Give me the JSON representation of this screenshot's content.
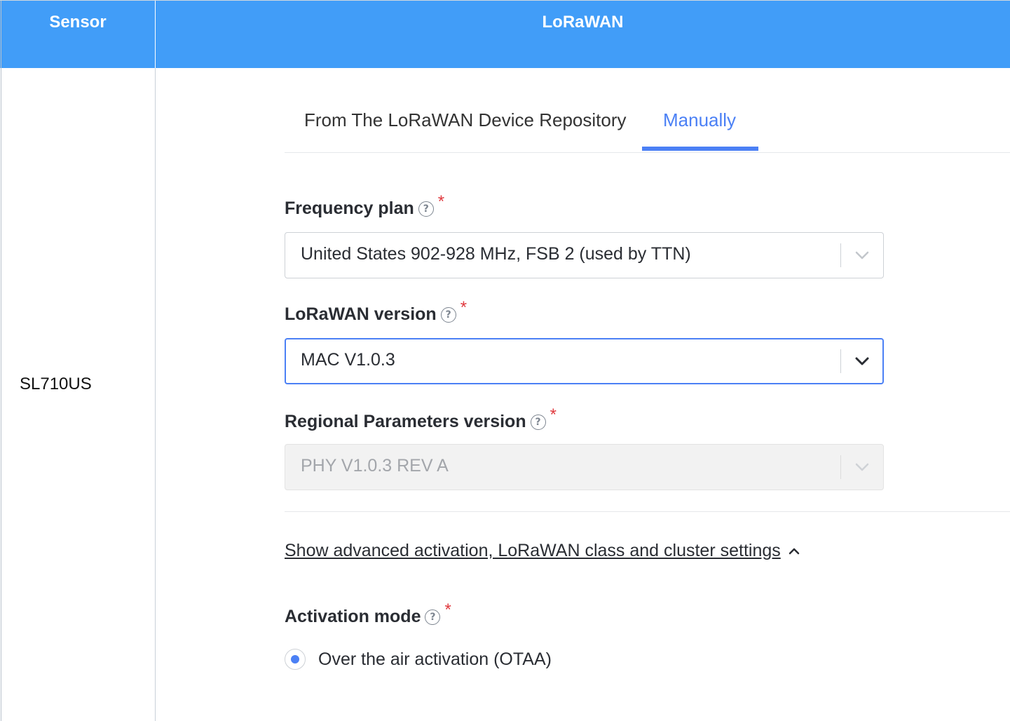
{
  "table": {
    "headers": {
      "sensor": "Sensor",
      "lorawan": "LoRaWAN"
    },
    "row": {
      "sensor": "SL710US"
    }
  },
  "tabs": [
    {
      "label": "From The LoRaWAN Device Repository",
      "active": false
    },
    {
      "label": "Manually",
      "active": true
    }
  ],
  "form": {
    "frequency_plan": {
      "label": "Frequency plan",
      "required_mark": "*",
      "value": "United States 902-928 MHz, FSB 2 (used by TTN)"
    },
    "lorawan_version": {
      "label": "LoRaWAN version",
      "required_mark": "*",
      "value": "MAC V1.0.3"
    },
    "regional_parameters_version": {
      "label": "Regional Parameters version",
      "required_mark": "*",
      "value": "PHY V1.0.3 REV A",
      "disabled": true
    },
    "advanced_link": "Show advanced activation, LoRaWAN class and cluster settings",
    "activation_mode": {
      "label": "Activation mode",
      "required_mark": "*",
      "option": "Over the air activation (OTAA)",
      "selected": true
    }
  },
  "icons": {
    "help": "help-circle-icon",
    "chevron": "chevron-down-icon",
    "caret_up": "caret-up-icon"
  },
  "colors": {
    "header_bg": "#419df8",
    "accent": "#4b80f5",
    "required": "#e0393e"
  }
}
